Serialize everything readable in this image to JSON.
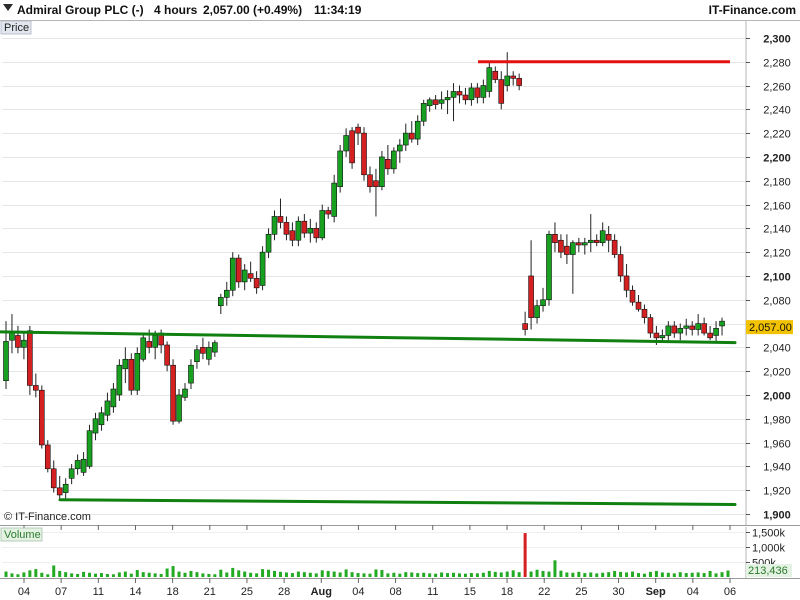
{
  "header": {
    "instrument": "Admiral Group PLC (-)",
    "timeframe": "4 hours",
    "last_change": "2,057.00 (+0.49%)",
    "time": "11:34:19",
    "brand": "IT-Finance.com"
  },
  "watermark": "© IT-Finance.com",
  "colors": {
    "up": "#18a020",
    "down": "#d42020",
    "trend_green": "#108010",
    "resistance_red": "#e51010",
    "price_tag": "#f2c200",
    "volume": "#22aa22",
    "volume_spike": "#d42020",
    "panel_label_bg": "#e2e6ee",
    "volume_label_bg": "#e4f2e4"
  },
  "chart_data": {
    "type": "candlestick",
    "price_panel": {
      "label": "Price",
      "ylim": [
        1900,
        2310
      ],
      "y_ticks": [
        1900,
        1920,
        1940,
        1960,
        1980,
        2000,
        2020,
        2040,
        2060,
        2080,
        2100,
        2120,
        2140,
        2160,
        2180,
        2200,
        2220,
        2240,
        2260,
        2280,
        2300
      ],
      "y_tick_labels": [
        "1,900",
        "1,920",
        "1,940",
        "1,960",
        "1,980",
        "2,000",
        "2,020",
        "2,040",
        "2,060",
        "2,080",
        "2,100",
        "2,120",
        "2,140",
        "2,160",
        "2,180",
        "2,200",
        "2,220",
        "2,240",
        "2,260",
        "2,280",
        "2,300"
      ],
      "bold_ticks": [
        "1,900",
        "2,000",
        "2,100",
        "2,200",
        "2,300"
      ],
      "last_price_label": "2,057.00",
      "last_price": 2057,
      "candles": [
        {
          "o": 2012,
          "h": 2062,
          "l": 2005,
          "c": 2045
        },
        {
          "o": 2046,
          "h": 2068,
          "l": 2035,
          "c": 2052
        },
        {
          "o": 2050,
          "h": 2058,
          "l": 2035,
          "c": 2040
        },
        {
          "o": 2040,
          "h": 2052,
          "l": 2030,
          "c": 2046
        },
        {
          "o": 2054,
          "h": 2058,
          "l": 2000,
          "c": 2008
        },
        {
          "o": 2008,
          "h": 2018,
          "l": 1998,
          "c": 2004
        },
        {
          "o": 2004,
          "h": 2008,
          "l": 1955,
          "c": 1958
        },
        {
          "o": 1958,
          "h": 1962,
          "l": 1935,
          "c": 1938
        },
        {
          "o": 1938,
          "h": 1945,
          "l": 1918,
          "c": 1922
        },
        {
          "o": 1922,
          "h": 1932,
          "l": 1912,
          "c": 1916
        },
        {
          "o": 1918,
          "h": 1930,
          "l": 1912,
          "c": 1925
        },
        {
          "o": 1930,
          "h": 1942,
          "l": 1925,
          "c": 1938
        },
        {
          "o": 1938,
          "h": 1950,
          "l": 1933,
          "c": 1945
        },
        {
          "o": 1935,
          "h": 1952,
          "l": 1932,
          "c": 1946
        },
        {
          "o": 1940,
          "h": 1975,
          "l": 1938,
          "c": 1970
        },
        {
          "o": 1968,
          "h": 1985,
          "l": 1962,
          "c": 1980
        },
        {
          "o": 1975,
          "h": 1990,
          "l": 1970,
          "c": 1985
        },
        {
          "o": 1983,
          "h": 2002,
          "l": 1978,
          "c": 1995
        },
        {
          "o": 1990,
          "h": 2010,
          "l": 1985,
          "c": 2005
        },
        {
          "o": 2000,
          "h": 2030,
          "l": 1995,
          "c": 2025
        },
        {
          "o": 2022,
          "h": 2040,
          "l": 2010,
          "c": 2030
        },
        {
          "o": 2030,
          "h": 2035,
          "l": 2000,
          "c": 2004
        },
        {
          "o": 2004,
          "h": 2040,
          "l": 2000,
          "c": 2035
        },
        {
          "o": 2030,
          "h": 2052,
          "l": 2028,
          "c": 2048
        },
        {
          "o": 2045,
          "h": 2055,
          "l": 2035,
          "c": 2040
        },
        {
          "o": 2040,
          "h": 2054,
          "l": 2030,
          "c": 2050
        },
        {
          "o": 2052,
          "h": 2055,
          "l": 2035,
          "c": 2042
        },
        {
          "o": 2042,
          "h": 2045,
          "l": 2020,
          "c": 2025
        },
        {
          "o": 2025,
          "h": 2030,
          "l": 1975,
          "c": 1978
        },
        {
          "o": 1978,
          "h": 2005,
          "l": 1976,
          "c": 2000
        },
        {
          "o": 1998,
          "h": 2010,
          "l": 1995,
          "c": 2005
        },
        {
          "o": 2010,
          "h": 2030,
          "l": 2005,
          "c": 2025
        },
        {
          "o": 2028,
          "h": 2042,
          "l": 2022,
          "c": 2038
        },
        {
          "o": 2040,
          "h": 2048,
          "l": 2030,
          "c": 2035
        },
        {
          "o": 2030,
          "h": 2045,
          "l": 2025,
          "c": 2040
        },
        {
          "o": 2036,
          "h": 2046,
          "l": 2032,
          "c": 2044
        },
        {
          "o": 2075,
          "h": 2085,
          "l": 2068,
          "c": 2082
        },
        {
          "o": 2082,
          "h": 2095,
          "l": 2075,
          "c": 2088
        },
        {
          "o": 2088,
          "h": 2120,
          "l": 2083,
          "c": 2115
        },
        {
          "o": 2115,
          "h": 2118,
          "l": 2090,
          "c": 2095
        },
        {
          "o": 2095,
          "h": 2110,
          "l": 2088,
          "c": 2105
        },
        {
          "o": 2102,
          "h": 2112,
          "l": 2095,
          "c": 2098
        },
        {
          "o": 2098,
          "h": 2104,
          "l": 2085,
          "c": 2090
        },
        {
          "o": 2092,
          "h": 2125,
          "l": 2088,
          "c": 2120
        },
        {
          "o": 2120,
          "h": 2140,
          "l": 2115,
          "c": 2135
        },
        {
          "o": 2135,
          "h": 2155,
          "l": 2130,
          "c": 2150
        },
        {
          "o": 2150,
          "h": 2165,
          "l": 2140,
          "c": 2145
        },
        {
          "o": 2145,
          "h": 2150,
          "l": 2130,
          "c": 2135
        },
        {
          "o": 2138,
          "h": 2145,
          "l": 2125,
          "c": 2130
        },
        {
          "o": 2130,
          "h": 2150,
          "l": 2125,
          "c": 2146
        },
        {
          "o": 2146,
          "h": 2152,
          "l": 2132,
          "c": 2136
        },
        {
          "o": 2136,
          "h": 2148,
          "l": 2128,
          "c": 2140
        },
        {
          "o": 2140,
          "h": 2145,
          "l": 2128,
          "c": 2132
        },
        {
          "o": 2132,
          "h": 2160,
          "l": 2130,
          "c": 2155
        },
        {
          "o": 2155,
          "h": 2158,
          "l": 2148,
          "c": 2152
        },
        {
          "o": 2150,
          "h": 2185,
          "l": 2145,
          "c": 2178
        },
        {
          "o": 2175,
          "h": 2210,
          "l": 2170,
          "c": 2205
        },
        {
          "o": 2205,
          "h": 2224,
          "l": 2200,
          "c": 2218
        },
        {
          "o": 2222,
          "h": 2225,
          "l": 2190,
          "c": 2195
        },
        {
          "o": 2225,
          "h": 2228,
          "l": 2210,
          "c": 2220
        },
        {
          "o": 2220,
          "h": 2225,
          "l": 2180,
          "c": 2185
        },
        {
          "o": 2185,
          "h": 2192,
          "l": 2170,
          "c": 2175
        },
        {
          "o": 2180,
          "h": 2190,
          "l": 2150,
          "c": 2175
        },
        {
          "o": 2175,
          "h": 2205,
          "l": 2172,
          "c": 2200
        },
        {
          "o": 2198,
          "h": 2210,
          "l": 2185,
          "c": 2190
        },
        {
          "o": 2190,
          "h": 2208,
          "l": 2186,
          "c": 2205
        },
        {
          "o": 2205,
          "h": 2215,
          "l": 2195,
          "c": 2210
        },
        {
          "o": 2210,
          "h": 2228,
          "l": 2205,
          "c": 2220
        },
        {
          "o": 2220,
          "h": 2230,
          "l": 2212,
          "c": 2215
        },
        {
          "o": 2215,
          "h": 2235,
          "l": 2210,
          "c": 2230
        },
        {
          "o": 2230,
          "h": 2248,
          "l": 2226,
          "c": 2245
        },
        {
          "o": 2243,
          "h": 2250,
          "l": 2238,
          "c": 2248
        },
        {
          "o": 2248,
          "h": 2252,
          "l": 2240,
          "c": 2244
        },
        {
          "o": 2245,
          "h": 2255,
          "l": 2240,
          "c": 2248
        },
        {
          "o": 2248,
          "h": 2256,
          "l": 2236,
          "c": 2250
        },
        {
          "o": 2250,
          "h": 2262,
          "l": 2230,
          "c": 2255
        },
        {
          "o": 2255,
          "h": 2260,
          "l": 2245,
          "c": 2252
        },
        {
          "o": 2252,
          "h": 2258,
          "l": 2244,
          "c": 2248
        },
        {
          "o": 2248,
          "h": 2262,
          "l": 2243,
          "c": 2258
        },
        {
          "o": 2258,
          "h": 2262,
          "l": 2245,
          "c": 2250
        },
        {
          "o": 2250,
          "h": 2265,
          "l": 2245,
          "c": 2260
        },
        {
          "o": 2255,
          "h": 2280,
          "l": 2250,
          "c": 2275
        },
        {
          "o": 2272,
          "h": 2276,
          "l": 2262,
          "c": 2265
        },
        {
          "o": 2265,
          "h": 2272,
          "l": 2240,
          "c": 2245
        },
        {
          "o": 2260,
          "h": 2288,
          "l": 2255,
          "c": 2268
        },
        {
          "o": 2268,
          "h": 2272,
          "l": 2260,
          "c": 2266
        },
        {
          "o": 2266,
          "h": 2270,
          "l": 2256,
          "c": 2260
        },
        {
          "o": 2060,
          "h": 2070,
          "l": 2050,
          "c": 2055
        },
        {
          "o": 2100,
          "h": 2130,
          "l": 2055,
          "c": 2065
        },
        {
          "o": 2065,
          "h": 2080,
          "l": 2060,
          "c": 2075
        },
        {
          "o": 2075,
          "h": 2090,
          "l": 2070,
          "c": 2080
        },
        {
          "o": 2080,
          "h": 2138,
          "l": 2075,
          "c": 2135
        },
        {
          "o": 2135,
          "h": 2145,
          "l": 2120,
          "c": 2128
        },
        {
          "o": 2130,
          "h": 2135,
          "l": 2115,
          "c": 2120
        },
        {
          "o": 2125,
          "h": 2135,
          "l": 2110,
          "c": 2118
        },
        {
          "o": 2118,
          "h": 2130,
          "l": 2085,
          "c": 2128
        },
        {
          "o": 2128,
          "h": 2132,
          "l": 2120,
          "c": 2126
        },
        {
          "o": 2126,
          "h": 2132,
          "l": 2118,
          "c": 2128
        },
        {
          "o": 2128,
          "h": 2152,
          "l": 2120,
          "c": 2130
        },
        {
          "o": 2130,
          "h": 2135,
          "l": 2125,
          "c": 2128
        },
        {
          "o": 2128,
          "h": 2145,
          "l": 2125,
          "c": 2138
        },
        {
          "o": 2135,
          "h": 2142,
          "l": 2120,
          "c": 2130
        },
        {
          "o": 2130,
          "h": 2135,
          "l": 2115,
          "c": 2118
        },
        {
          "o": 2118,
          "h": 2125,
          "l": 2095,
          "c": 2100
        },
        {
          "o": 2100,
          "h": 2110,
          "l": 2082,
          "c": 2088
        },
        {
          "o": 2088,
          "h": 2092,
          "l": 2075,
          "c": 2078
        },
        {
          "o": 2078,
          "h": 2084,
          "l": 2070,
          "c": 2072
        },
        {
          "o": 2072,
          "h": 2076,
          "l": 2060,
          "c": 2065
        },
        {
          "o": 2065,
          "h": 2068,
          "l": 2048,
          "c": 2052
        },
        {
          "o": 2052,
          "h": 2058,
          "l": 2042,
          "c": 2048
        },
        {
          "o": 2048,
          "h": 2055,
          "l": 2045,
          "c": 2050
        },
        {
          "o": 2050,
          "h": 2062,
          "l": 2046,
          "c": 2058
        },
        {
          "o": 2058,
          "h": 2062,
          "l": 2048,
          "c": 2052
        },
        {
          "o": 2052,
          "h": 2060,
          "l": 2046,
          "c": 2056
        },
        {
          "o": 2056,
          "h": 2064,
          "l": 2050,
          "c": 2058
        },
        {
          "o": 2058,
          "h": 2062,
          "l": 2050,
          "c": 2055
        },
        {
          "o": 2055,
          "h": 2068,
          "l": 2050,
          "c": 2060
        },
        {
          "o": 2060,
          "h": 2065,
          "l": 2050,
          "c": 2052
        },
        {
          "o": 2052,
          "h": 2058,
          "l": 2046,
          "c": 2048
        },
        {
          "o": 2050,
          "h": 2062,
          "l": 2045,
          "c": 2056
        },
        {
          "o": 2058,
          "h": 2065,
          "l": 2050,
          "c": 2062
        }
      ],
      "support_upper": {
        "from": 2053,
        "to": 2044
      },
      "support_lower": {
        "from": 1912,
        "to": 1908
      },
      "resistance": {
        "value": 2280
      }
    },
    "volume_panel": {
      "label": "Volume",
      "ylim": [
        0,
        1650000
      ],
      "y_ticks": [
        500000,
        1000000,
        1500000
      ],
      "y_tick_labels": [
        "500k",
        "1,000k",
        "1,500k"
      ],
      "last_volume_label": "213,436",
      "values": [
        180000,
        120000,
        90000,
        150000,
        220000,
        260000,
        140000,
        90000,
        380000,
        200000,
        160000,
        120000,
        100000,
        170000,
        140000,
        110000,
        130000,
        100000,
        90000,
        150000,
        180000,
        110000,
        230000,
        160000,
        140000,
        120000,
        100000,
        280000,
        360000,
        180000,
        140000,
        200000,
        160000,
        120000,
        100000,
        90000,
        240000,
        150000,
        300000,
        220000,
        180000,
        140000,
        120000,
        260000,
        240000,
        200000,
        170000,
        150000,
        130000,
        180000,
        160000,
        140000,
        120000,
        220000,
        200000,
        180000,
        150000,
        250000,
        160000,
        130000,
        120000,
        110000,
        250000,
        230000,
        120000,
        140000,
        110000,
        160000,
        150000,
        130000,
        140000,
        120000,
        110000,
        150000,
        130000,
        140000,
        120000,
        110000,
        130000,
        120000,
        140000,
        200000,
        170000,
        150000,
        180000,
        220000,
        160000,
        1450000,
        180000,
        240000,
        200000,
        180000,
        550000,
        210000,
        150000,
        140000,
        170000,
        130000,
        150000,
        120000,
        140000,
        160000,
        200000,
        170000,
        150000,
        180000,
        130000,
        110000,
        170000,
        200000,
        150000,
        140000,
        120000,
        160000,
        130000,
        140000,
        150000,
        130000,
        200000,
        120000,
        160000,
        213436
      ],
      "spike_index": 87
    },
    "x_axis": {
      "tick_labels": [
        "04",
        "07",
        "11",
        "14",
        "18",
        "21",
        "25",
        "28",
        "Aug",
        "04",
        "08",
        "11",
        "15",
        "18",
        "22",
        "25",
        "30",
        "Sep",
        "04",
        "06"
      ],
      "bold_labels": [
        "Aug",
        "Sep"
      ]
    }
  }
}
